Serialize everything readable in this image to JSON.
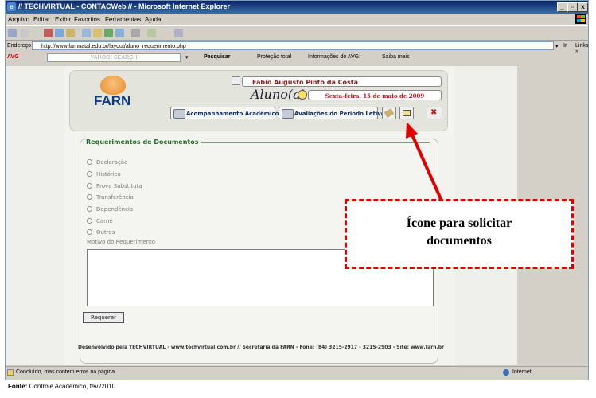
{
  "window": {
    "title": "// TECHVIRTUAL - CONTACWeb // - Microsoft Internet Explorer",
    "min": "_",
    "max": "▫",
    "close": "x"
  },
  "menu": [
    "Arquivo",
    "Editar",
    "Exibir",
    "Favoritos",
    "Ferramentas",
    "Ajuda"
  ],
  "address": {
    "label": "Endereço",
    "url": "http://www.farnnatal.edu.br/layout/aluno_requerimento.php",
    "go": "Ir",
    "links": "Links »"
  },
  "avg": {
    "label": "AVG",
    "search_placeholder": "YAHOO! SEARCH",
    "pesquisar": "Pesquisar",
    "protecao": "Proteção total",
    "informacoes": "Informações do AVG:",
    "saiba": "Saiba mais"
  },
  "header": {
    "logo_text": "FARN",
    "name": "Fábio Augusto Pinto da Costa",
    "role": "Aluno(a)",
    "date": "Sexta-feira, 15 de maio de 2009",
    "nav_acompanhamento": "Acompanhamento Acadêmico",
    "nav_avaliacoes": "Avaliações do Periodo Letivo"
  },
  "form": {
    "legend": "Requerimentos de Documentos",
    "options": [
      "Declaração",
      "Histórico",
      "Prova Substituta",
      "Transferência",
      "Dependência",
      "Carnê",
      "Outros"
    ],
    "motivo_label": "Motivo do Requerimento",
    "submit": "Requerer"
  },
  "footer": {
    "text": "Desenvolvido pela TECHVIRTUAL - www.techvirtual.com.br // Secretaria da FARN - Fone: (84) 3215-2917 - 3215-2903 - Site: www.farn.br"
  },
  "status": {
    "message": "Concluído, mas contém erros na página.",
    "zone": "Internet"
  },
  "callout": {
    "line1": "Ícone para solicitar",
    "line2": "documentos"
  },
  "source": "Fonte: Controle Acadêmico, fev./2010",
  "colors": {
    "titlebar": "#0a246a",
    "callout_border": "#e00000",
    "name_text": "#8b1b1b"
  }
}
